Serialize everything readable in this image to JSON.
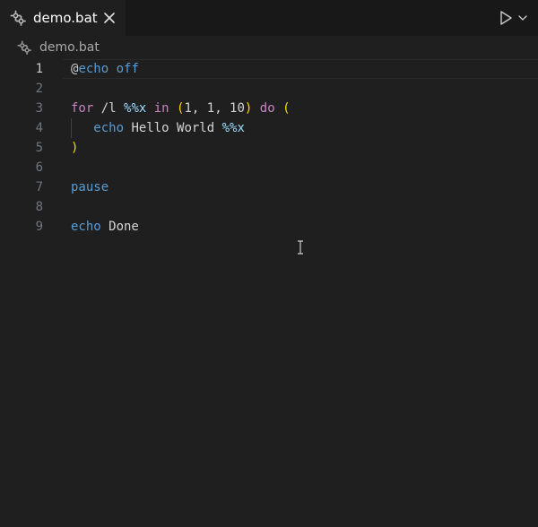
{
  "tab": {
    "label": "demo.bat",
    "icon": "gear-icon",
    "close_icon": "close-icon"
  },
  "toolbar": {
    "run_icon": "play-icon",
    "run_menu_icon": "chevron-down-icon"
  },
  "breadcrumb": {
    "label": "demo.bat",
    "icon": "gear-icon"
  },
  "editor": {
    "active_line": 1,
    "lines": [
      {
        "number": "1",
        "tokens": [
          {
            "t": "@",
            "c": "at"
          },
          {
            "t": "echo off",
            "c": "cmd"
          }
        ]
      },
      {
        "number": "2",
        "tokens": []
      },
      {
        "number": "3",
        "tokens": [
          {
            "t": "for",
            "c": "kw"
          },
          {
            "t": " /l ",
            "c": "txt"
          },
          {
            "t": "%%x",
            "c": "var"
          },
          {
            "t": " ",
            "c": "txt"
          },
          {
            "t": "in",
            "c": "kw"
          },
          {
            "t": " ",
            "c": "txt"
          },
          {
            "t": "(",
            "c": "paren"
          },
          {
            "t": "1, 1, 10",
            "c": "txt"
          },
          {
            "t": ")",
            "c": "paren"
          },
          {
            "t": " ",
            "c": "txt"
          },
          {
            "t": "do",
            "c": "kw"
          },
          {
            "t": " ",
            "c": "txt"
          },
          {
            "t": "(",
            "c": "paren"
          }
        ]
      },
      {
        "number": "4",
        "tokens": [
          {
            "t": "   ",
            "c": "txt"
          },
          {
            "t": "echo",
            "c": "cmd"
          },
          {
            "t": " Hello World ",
            "c": "txt"
          },
          {
            "t": "%%x",
            "c": "var"
          }
        ]
      },
      {
        "number": "5",
        "tokens": [
          {
            "t": ")",
            "c": "paren"
          }
        ]
      },
      {
        "number": "6",
        "tokens": []
      },
      {
        "number": "7",
        "tokens": [
          {
            "t": "pause",
            "c": "cmd"
          }
        ]
      },
      {
        "number": "8",
        "tokens": []
      },
      {
        "number": "9",
        "tokens": [
          {
            "t": "echo",
            "c": "cmd"
          },
          {
            "t": " Done",
            "c": "txt"
          }
        ]
      }
    ]
  },
  "colors": {
    "background": "#1f1f1f",
    "tabbar": "#181818",
    "keyword": "#c586c0",
    "command": "#569cd6",
    "variable": "#9cdcfe",
    "bracket": "#ffd700",
    "text": "#d4d4d4",
    "line_number": "#6e7681"
  },
  "cursor_icon": "text-cursor-icon"
}
